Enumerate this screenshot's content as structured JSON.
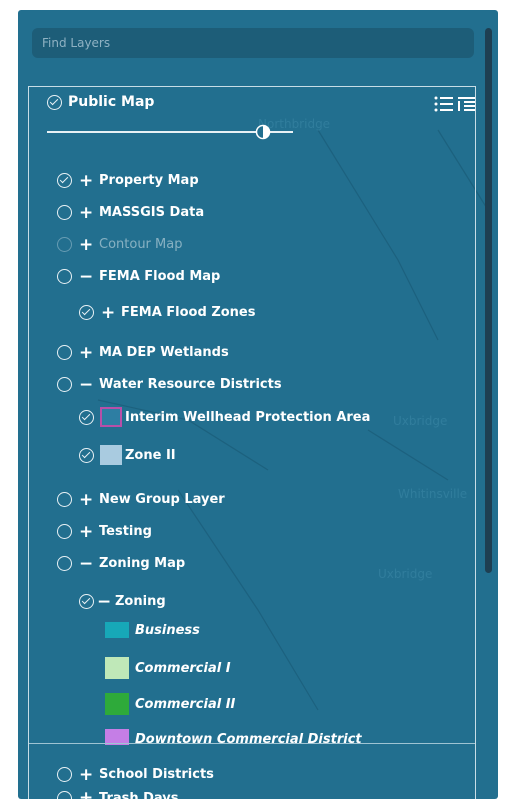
{
  "search": {
    "placeholder": "Find Layers"
  },
  "root": {
    "label": "Public Map"
  },
  "opacity_slider": {
    "value": 0.85
  },
  "layers": {
    "property_map": "Property Map",
    "massgis": "MASSGIS Data",
    "contour": "Contour Map",
    "fema_map": "FEMA Flood Map",
    "fema_zones": "FEMA Flood Zones",
    "wetlands": "MA DEP Wetlands",
    "water": "Water Resource Districts",
    "wellhead": "Interim Wellhead Protection Area",
    "zone2": "Zone II",
    "new_group": "New Group Layer",
    "testing": "Testing",
    "zoning_map": "Zoning Map",
    "zoning": "Zoning",
    "school": "School Districts",
    "trash": "Trash Days"
  },
  "signs": {
    "plus": "+",
    "minus": "−"
  },
  "legend": [
    {
      "label": "Business",
      "color": "#17a8b8"
    },
    {
      "label": "Commercial I",
      "color": "#bfe8b8"
    },
    {
      "label": "Commercial II",
      "color": "#2eaa3a"
    },
    {
      "label": "Downtown Commercial District",
      "color": "#c57ee6"
    }
  ],
  "colors": {
    "panel": "#226f8f",
    "wellhead_border": "#b84fa8",
    "zone2_fill": "#a9cbe0"
  },
  "map_words": [
    "Northbridge",
    "Uxbridge",
    "Whitinsville",
    "Uxbridge"
  ]
}
